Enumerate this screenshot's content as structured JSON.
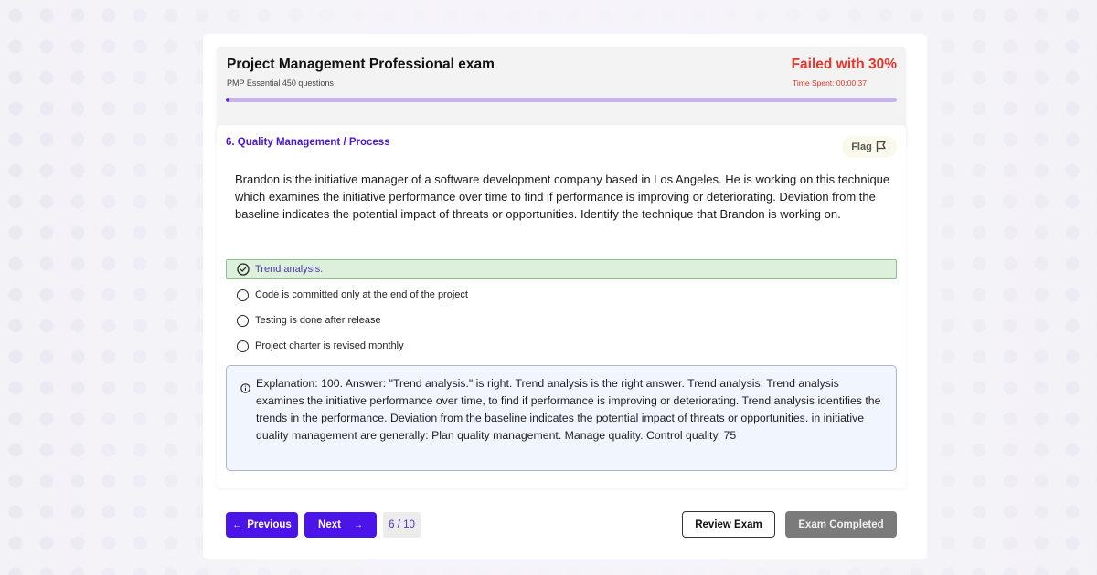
{
  "exam": {
    "title": "Project Management Professional exam",
    "subtitle": "PMP Essential 450 questions",
    "result": "Failed with 30%",
    "time_label": "Time Spent:",
    "time_value": "00:00:37",
    "progress_fraction": 0.004,
    "colors": {
      "accent": "#4b14e8",
      "fail": "#e2372d",
      "correct_bg": "#dcf0dc"
    }
  },
  "question": {
    "category": "6. Quality Management / Process",
    "flag_label": "Flag",
    "text": "Brandon is the initiative manager of a software development company based in Los Angeles. He is working on this technique which examines the initiative performance over time to find if performance is improving or deteriorating. Deviation from the baseline indicates the potential impact of threats or opportunities. Identify the technique that Brandon is working on.",
    "options": [
      {
        "label": "Trend analysis.",
        "state": "correct",
        "icon": "check-circle-icon"
      },
      {
        "label": "Code is committed only at the end of the project",
        "state": "unselected",
        "icon": "radio-icon"
      },
      {
        "label": "Testing is done after release",
        "state": "unselected",
        "icon": "radio-icon"
      },
      {
        "label": "Project charter is revised monthly",
        "state": "unselected",
        "icon": "radio-icon"
      }
    ],
    "explanation": "Explanation: 100. Answer: \"Trend analysis.\" is right. Trend analysis is the right answer. Trend analysis: Trend analysis examines the initiative performance over time, to find if performance is improving or deteriorating. Trend analysis identifies the trends in the performance. Deviation from the baseline indicates the potential impact of threats or opportunities. in initiative quality management are generally: Plan quality management. Manage quality. Control quality. 75"
  },
  "nav": {
    "previous_label": "Previous",
    "next_label": "Next",
    "counter": "6 / 10",
    "review_label": "Review Exam",
    "completed_label": "Exam Completed"
  }
}
